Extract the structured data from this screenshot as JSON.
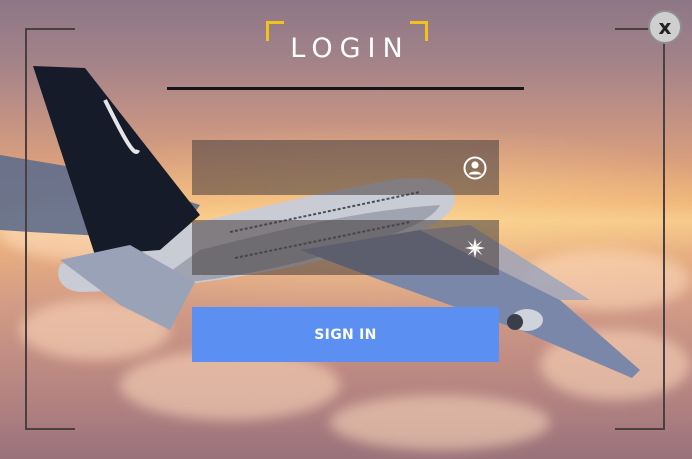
{
  "window": {
    "close_label": "x"
  },
  "header": {
    "title": "LOGIN"
  },
  "form": {
    "username": {
      "value": "",
      "placeholder": "",
      "icon": "user-icon"
    },
    "password": {
      "value": "",
      "placeholder": "",
      "icon": "asterisk-icon"
    },
    "submit_label": "SIGN IN"
  },
  "colors": {
    "accent_bracket": "#f2c21b",
    "button": "#5b8ff2",
    "field_bg": "rgba(70,60,60,0.55)"
  }
}
